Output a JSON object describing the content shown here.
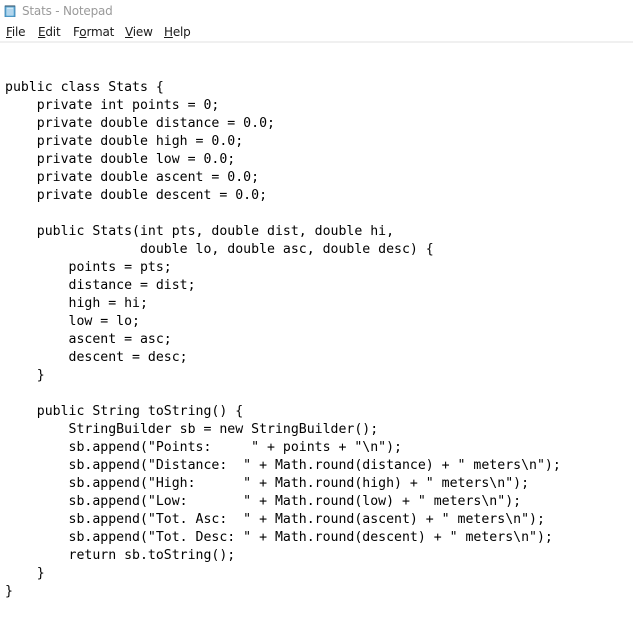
{
  "window": {
    "title": "Stats - Notepad",
    "icon": "notepad-icon"
  },
  "menu": [
    {
      "label": "File",
      "accel": "F",
      "rest": "ile"
    },
    {
      "label": "Edit",
      "accel": "E",
      "rest": "dit"
    },
    {
      "label": "Format",
      "pre": "F",
      "accel": "o",
      "rest": "rmat"
    },
    {
      "label": "View",
      "accel": "V",
      "rest": "iew"
    },
    {
      "label": "Help",
      "accel": "H",
      "rest": "elp"
    }
  ],
  "editor": {
    "lines": [
      "public class Stats {",
      "    private int points = 0;",
      "    private double distance = 0.0;",
      "    private double high = 0.0;",
      "    private double low = 0.0;",
      "    private double ascent = 0.0;",
      "    private double descent = 0.0;",
      "",
      "    public Stats(int pts, double dist, double hi,",
      "                 double lo, double asc, double desc) {",
      "        points = pts;",
      "        distance = dist;",
      "        high = hi;",
      "        low = lo;",
      "        ascent = asc;",
      "        descent = desc;",
      "    }",
      "",
      "    public String toString() {",
      "        StringBuilder sb = new StringBuilder();",
      "        sb.append(\"Points:     \" + points + \"\\n\");",
      "        sb.append(\"Distance:  \" + Math.round(distance) + \" meters\\n\");",
      "        sb.append(\"High:      \" + Math.round(high) + \" meters\\n\");",
      "        sb.append(\"Low:       \" + Math.round(low) + \" meters\\n\");",
      "        sb.append(\"Tot. Asc:  \" + Math.round(ascent) + \" meters\\n\");",
      "        sb.append(\"Tot. Desc: \" + Math.round(descent) + \" meters\\n\");",
      "        return sb.toString();",
      "    }",
      "}"
    ]
  }
}
